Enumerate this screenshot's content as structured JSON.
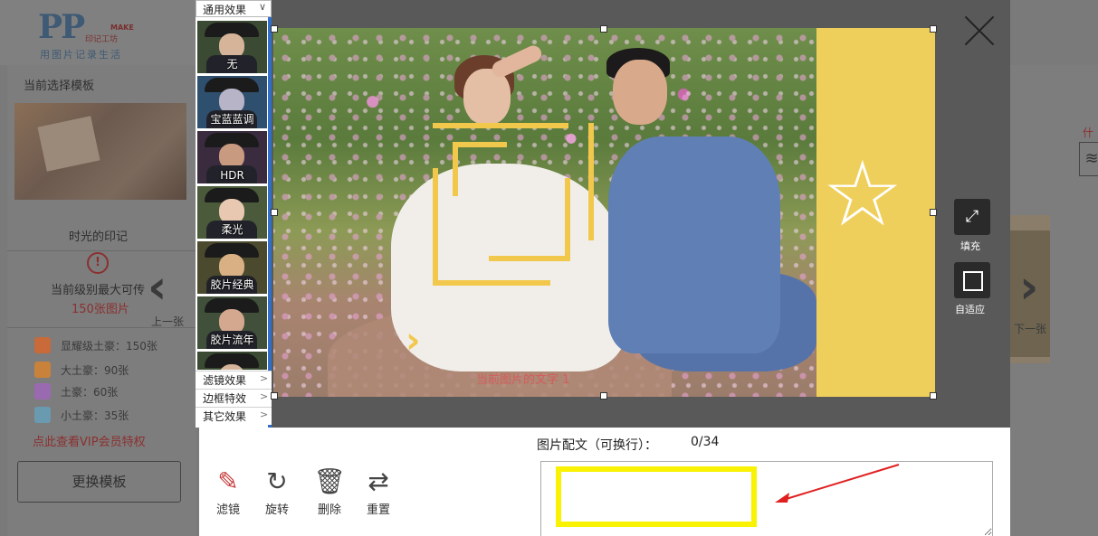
{
  "logo": {
    "mark": "PP",
    "make": "MAKE",
    "make2": "印记工坊",
    "slogan": "用图片记录生活"
  },
  "sidebar": {
    "current_template_label": "当前选择模板",
    "template_name": "时光的印记",
    "level_text": "当前级别最大可传",
    "max_photos": "150张图片",
    "vip_levels": [
      {
        "label": "显耀级土豪：150张",
        "color": "#c86a3a"
      },
      {
        "label": "大土豪：90张",
        "color": "#c8823a"
      },
      {
        "label": "土豪：60张",
        "color": "#9a6ab0"
      },
      {
        "label": "小土豪：35张",
        "color": "#6a9ab0"
      }
    ],
    "vip_link": "点此查看VIP会员特权",
    "change_template_button": "更换模板"
  },
  "nav": {
    "prev_label": "上一张",
    "next_label": "下一张",
    "prev_icon": "chevron-left-icon",
    "next_icon": "chevron-right-icon"
  },
  "right_peek": {
    "what_link": "什么",
    "layers_icon": "layers-icon"
  },
  "effects": {
    "header": "通用效果",
    "items": [
      "无",
      "宝蓝蓝调",
      "HDR",
      "柔光",
      "胶片经典",
      "胶片流年"
    ],
    "categories": [
      "滤镜效果",
      "边框特效",
      "其它效果"
    ]
  },
  "editor": {
    "caption_overlay": "当前图片的文字 1",
    "fill_label": "填充",
    "fit_label": "自适应",
    "accent_color": "#efcf5b"
  },
  "toolbar": {
    "tools": [
      {
        "label": "滤镜",
        "icon": "magic-wand-icon"
      },
      {
        "label": "旋转",
        "icon": "rotate-icon"
      },
      {
        "label": "删除",
        "icon": "trash-icon"
      },
      {
        "label": "重置",
        "icon": "reset-icon"
      }
    ]
  },
  "caption_editor": {
    "label": "图片配文（可换行）：",
    "count": "0/34",
    "value": ""
  }
}
